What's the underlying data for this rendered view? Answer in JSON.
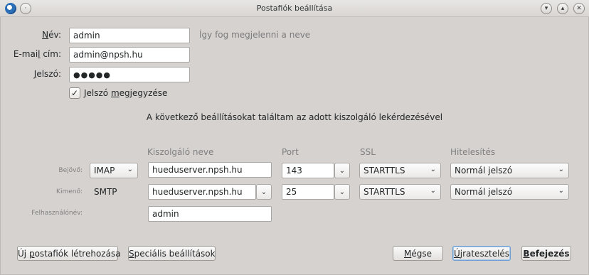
{
  "window": {
    "title": "Postafiók beállítása"
  },
  "form": {
    "name_label_pre": "",
    "name_label_ul": "N",
    "name_label_post": "év:",
    "name_value": "admin",
    "name_hint": "Így fog megjelenni a neve",
    "email_label_pre": "E-mai",
    "email_label_ul": "l",
    "email_label_post": " cím:",
    "email_value": "admin@npsh.hu",
    "password_label_pre": "",
    "password_label_ul": "J",
    "password_label_post": "elszó:",
    "password_value": "●●●●●",
    "remember_label_pre": "Jelszó ",
    "remember_label_ul": "m",
    "remember_label_post": "egjegyzése",
    "remember_checked": true
  },
  "found_message": "A következő beállításokat találtam az adott kiszolgáló lekérdezésével",
  "columns": {
    "server": "Kiszolgáló neve",
    "port": "Port",
    "ssl": "SSL",
    "auth": "Hitelesítés"
  },
  "incoming": {
    "label": "Bejövő:",
    "protocol": "IMAP",
    "server": "hueduserver.npsh.hu",
    "port": "143",
    "ssl": "STARTTLS",
    "auth": "Normál jelszó"
  },
  "outgoing": {
    "label": "Kimenő:",
    "protocol": "SMTP",
    "server": "hueduserver.npsh.hu",
    "port": "25",
    "ssl": "STARTTLS",
    "auth": "Normál jelszó"
  },
  "username": {
    "label": "Felhasználónév:",
    "value": "admin"
  },
  "buttons": {
    "new_account_pre": "Új ",
    "new_account_ul": "p",
    "new_account_post": "ostafiók létrehozása",
    "advanced_ul": "S",
    "advanced_post": "peciális beállítások",
    "cancel_ul": "M",
    "cancel_post": "égse",
    "retest_ul": "Ú",
    "retest_post": "jratesztelés",
    "done_ul": "B",
    "done_post": "efejezés"
  },
  "icons": {
    "app": "thunderbird-icon",
    "minimize": "chevron-down-icon",
    "maximize": "chevron-up-icon",
    "close": "close-icon",
    "dropdown": "chevron-down-icon",
    "check": "checkmark-icon"
  }
}
